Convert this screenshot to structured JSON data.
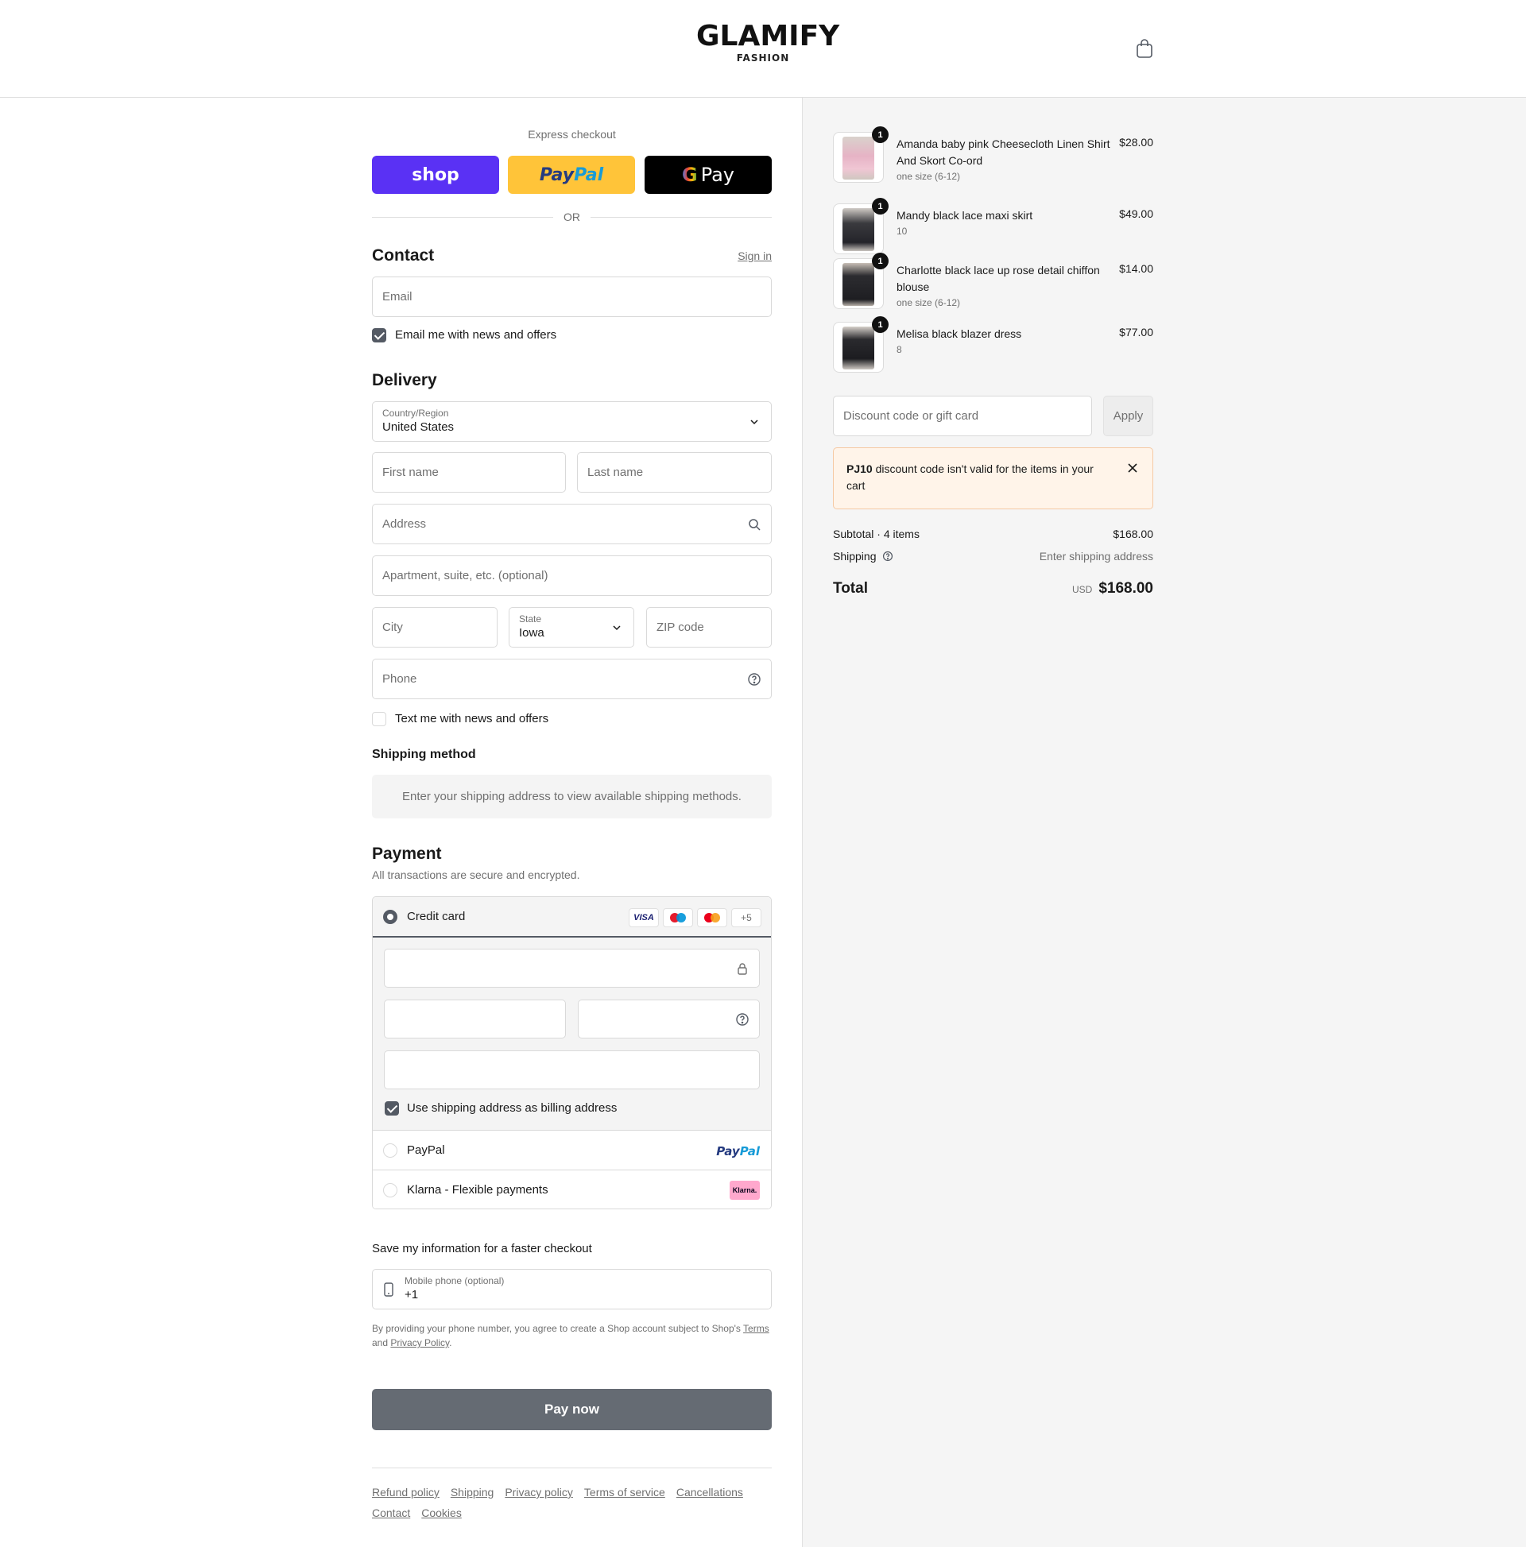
{
  "header": {
    "brand": "GLAMIFY",
    "brand_sub": "FASHION",
    "cart_icon": "shopping-bag-icon"
  },
  "express": {
    "label": "Express checkout",
    "shop_label": "shop",
    "paypal_part1": "Pay",
    "paypal_part2": "Pal",
    "gpay_g": "G",
    "gpay_label": "Pay",
    "or_label": "OR"
  },
  "contact": {
    "title": "Contact",
    "sign_in": "Sign in",
    "email_placeholder": "Email",
    "news_label": "Email me with news and offers",
    "news_checked": true
  },
  "delivery": {
    "title": "Delivery",
    "country_label": "Country/Region",
    "country_value": "United States",
    "first_name_placeholder": "First name",
    "last_name_placeholder": "Last name",
    "address_placeholder": "Address",
    "apartment_placeholder": "Apartment, suite, etc. (optional)",
    "city_placeholder": "City",
    "state_label": "State",
    "state_value": "Iowa",
    "zip_placeholder": "ZIP code",
    "phone_placeholder": "Phone",
    "text_label": "Text me with news and offers",
    "text_checked": false
  },
  "shipping_method": {
    "title": "Shipping method",
    "note": "Enter your shipping address to view available shipping methods."
  },
  "payment": {
    "title": "Payment",
    "subtitle": "All transactions are secure and encrypted.",
    "credit_card_label": "Credit card",
    "card_brands": [
      "VISA",
      "maestro",
      "mastercard"
    ],
    "more_cards": "+5",
    "billing_label": "Use shipping address as billing address",
    "billing_checked": true,
    "paypal_label": "PayPal",
    "paypal_logo_1": "Pay",
    "paypal_logo_2": "Pal",
    "klarna_label": "Klarna - Flexible payments",
    "klarna_logo": "Klarna."
  },
  "save_info": {
    "title": "Save my information for a faster checkout",
    "mobile_label": "Mobile phone (optional)",
    "mobile_value": "+1",
    "legal_prefix": "By providing your phone number, you agree to create a Shop account subject to Shop's",
    "terms_link": "Terms",
    "legal_and": "and",
    "privacy_link": "Privacy Policy",
    "legal_suffix": "."
  },
  "pay_now": "Pay now",
  "footer": {
    "links": [
      "Refund policy",
      "Shipping",
      "Privacy policy",
      "Terms of service",
      "Cancellations",
      "Contact",
      "Cookies"
    ]
  },
  "order": {
    "items": [
      {
        "name": "Amanda baby pink Cheesecloth Linen Shirt And Skort Co-ord",
        "variant": "one size (6-12)",
        "price": "$28.00",
        "qty": "1",
        "color": "#e8b8c8"
      },
      {
        "name": "Mandy black lace maxi skirt",
        "variant": "10",
        "price": "$49.00",
        "qty": "1",
        "color": "#2a2a2e"
      },
      {
        "name": "Charlotte black lace up rose detail chiffon blouse",
        "variant": "one size (6-12)",
        "price": "$14.00",
        "qty": "1",
        "color": "#26262a"
      },
      {
        "name": "Melisa black blazer dress",
        "variant": "8",
        "price": "$77.00",
        "qty": "1",
        "color": "#1f1f22"
      }
    ],
    "discount_placeholder": "Discount code or gift card",
    "apply_label": "Apply",
    "alert_code": "PJ10",
    "alert_text": "discount code isn't valid for the items in your cart",
    "subtotal_label": "Subtotal · 4 items",
    "subtotal_value": "$168.00",
    "shipping_label": "Shipping",
    "shipping_value": "Enter shipping address",
    "total_label": "Total",
    "total_currency": "USD",
    "total_value": "$168.00"
  }
}
